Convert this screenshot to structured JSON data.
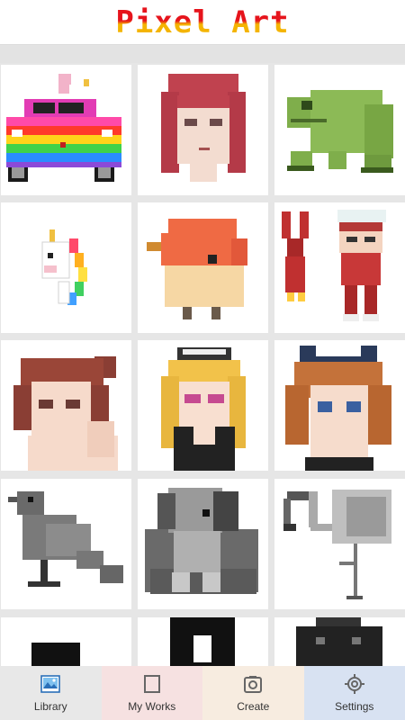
{
  "app": {
    "title": "Pixel Art"
  },
  "gallery": {
    "items": [
      {
        "name": "rainbow-car-unicorn"
      },
      {
        "name": "red-hair-girl"
      },
      {
        "name": "green-frog"
      },
      {
        "name": "rainbow-unicorn-head"
      },
      {
        "name": "orange-bird"
      },
      {
        "name": "robot-and-girl"
      },
      {
        "name": "anime-girl-brown-hair"
      },
      {
        "name": "maid-girl-glasses"
      },
      {
        "name": "cat-ear-girl"
      },
      {
        "name": "gray-crow"
      },
      {
        "name": "gray-puppy"
      },
      {
        "name": "gray-flamingo"
      }
    ]
  },
  "nav": {
    "library": {
      "label": "Library",
      "icon": "image-icon"
    },
    "myworks": {
      "label": "My Works",
      "icon": "square-icon"
    },
    "create": {
      "label": "Create",
      "icon": "camera-icon"
    },
    "settings": {
      "label": "Settings",
      "icon": "gear-icon"
    }
  }
}
